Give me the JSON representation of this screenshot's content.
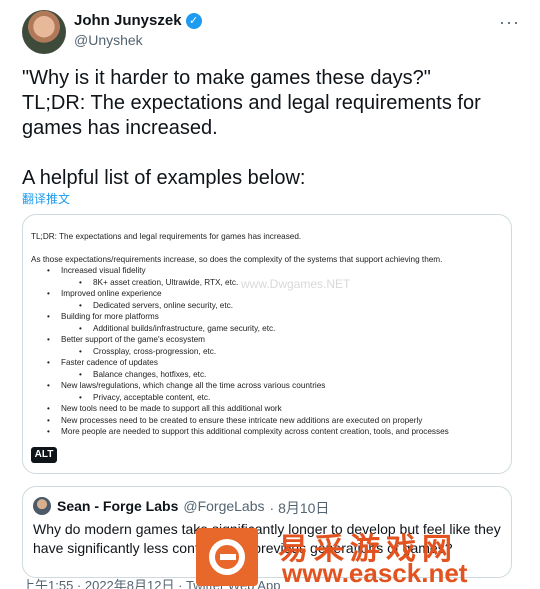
{
  "author": {
    "name": "John Junyszek",
    "handle": "@Unyshek",
    "verified_icon": "verified-badge-icon"
  },
  "more_icon": "more-options-icon",
  "tweet": {
    "line1": "\"Why is it harder to make games these days?\"",
    "line2": "TL;DR: The expectations and legal requirements for games has increased.",
    "line3": "A helpful list of examples below:"
  },
  "translate_label": "翻译推文",
  "image": {
    "alt_label": "ALT",
    "heading": "TL;DR: The expectations and legal requirements for games has increased.",
    "intro": "As those expectations/requirements increase, so does the complexity of the systems that support achieving them.",
    "items": [
      {
        "text": "Increased visual fidelity",
        "sub": "8K+ asset creation, Ultrawide, RTX, etc."
      },
      {
        "text": "Improved online experience",
        "sub": "Dedicated servers, online security, etc."
      },
      {
        "text": "Building for more platforms",
        "sub": "Additional builds/infrastructure, game security, etc."
      },
      {
        "text": "Better support of the game's ecosystem",
        "sub": "Crossplay, cross-progression, etc."
      },
      {
        "text": "Faster cadence of updates",
        "sub": "Balance changes, hotfixes, etc."
      },
      {
        "text": "New laws/regulations, which change all the time across various countries",
        "sub": "Privacy, acceptable content, etc."
      },
      {
        "text": "New tools need to be made to support all this additional work",
        "sub": ""
      },
      {
        "text": "New processes need to be created to ensure these intricate new additions are executed on properly",
        "sub": ""
      },
      {
        "text": "More people are needed to support this additional complexity across content creation, tools, and processes",
        "sub": ""
      }
    ],
    "faint_watermark": "www.Dwgames.NET"
  },
  "quote": {
    "name": "Sean - Forge Labs",
    "handle": "@ForgeLabs",
    "date": "· 8月10日",
    "text": "Why do modern games take significantly longer to develop but feel like they have significantly less content than previous generations of games?"
  },
  "timestamp": "上午1:55 · 2022年8月12日 · Twitter Web App",
  "watermark": {
    "cn": "易采游戏网",
    "url": "www.easck.net",
    "color": "#e2531f"
  },
  "colors": {
    "accent": "#1d9bf0",
    "secondary_text": "#536471",
    "border": "#cfd9de"
  }
}
